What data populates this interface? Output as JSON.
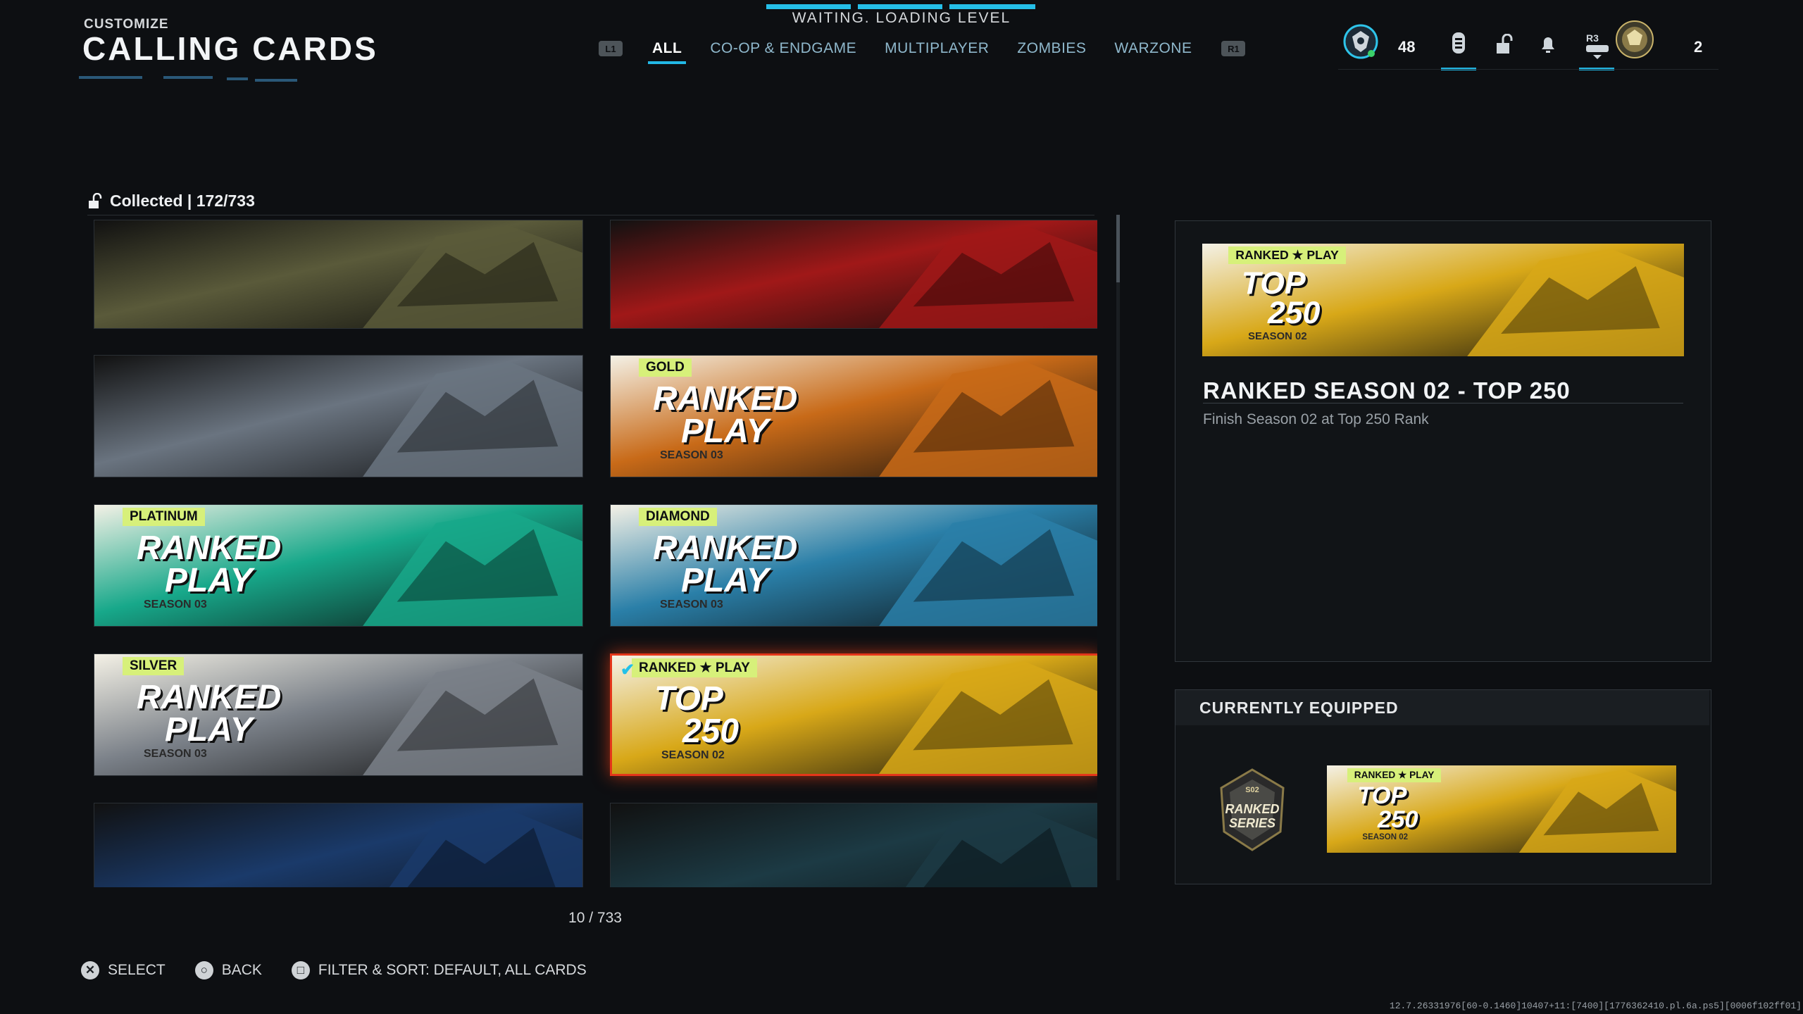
{
  "header": {
    "subtitle": "CUSTOMIZE",
    "title": "CALLING CARDS",
    "loading_text": "WAITING. LOADING LEVEL"
  },
  "nav": {
    "left_bumper": "L1",
    "right_bumper": "R1",
    "tabs": [
      {
        "label": "ALL",
        "active": true
      },
      {
        "label": "CO-OP & ENDGAME",
        "active": false
      },
      {
        "label": "MULTIPLAYER",
        "active": false
      },
      {
        "label": "ZOMBIES",
        "active": false
      },
      {
        "label": "WARZONE",
        "active": false
      }
    ]
  },
  "hud": {
    "level": "48",
    "r3_label": "R3",
    "count": "2",
    "icons": [
      "rank-emblem-icon",
      "inventory-icon",
      "lock-icon",
      "bell-icon",
      "controller-icon",
      "player-emblem-icon"
    ]
  },
  "collection": {
    "label": "Collected | 172/733",
    "pager": "10 / 733"
  },
  "cards": [
    {
      "name": "soldier-firefight-card",
      "theme": "#5a5a3a",
      "badge": "",
      "line1": "",
      "line2": "",
      "season": "",
      "selected": false
    },
    {
      "name": "commando-pistol-card",
      "theme": "#a01818",
      "badge": "",
      "line1": "",
      "line2": "",
      "season": "",
      "selected": false
    },
    {
      "name": "twin-snipers-card",
      "theme": "#6a7480",
      "badge": "",
      "line1": "",
      "line2": "",
      "season": "",
      "selected": false
    },
    {
      "name": "ranked-play-gold-card",
      "theme": "#c86a18",
      "badge": "GOLD",
      "line1": "RANKED",
      "line2": "PLAY",
      "season": "SEASON 03",
      "selected": false
    },
    {
      "name": "ranked-play-platinum-card",
      "theme": "#17a88a",
      "badge": "PLATINUM",
      "line1": "RANKED",
      "line2": "PLAY",
      "season": "SEASON 03",
      "selected": false
    },
    {
      "name": "ranked-play-diamond-card",
      "theme": "#2a7fa8",
      "badge": "DIAMOND",
      "line1": "RANKED",
      "line2": "PLAY",
      "season": "SEASON 03",
      "selected": false
    },
    {
      "name": "ranked-play-silver-card",
      "theme": "#7a8088",
      "badge": "SILVER",
      "line1": "RANKED",
      "line2": "PLAY",
      "season": "SEASON 03",
      "selected": false
    },
    {
      "name": "ranked-top-250-card",
      "theme": "#d8a818",
      "badge": "RANKED ★ PLAY",
      "line1": "TOP",
      "line2": "250",
      "season": "SEASON 02",
      "selected": true
    },
    {
      "name": "storm-moon-card",
      "theme": "#1a3a6a",
      "badge": "",
      "line1": "",
      "line2": "",
      "season": "",
      "selected": false
    },
    {
      "name": "combat-knife-card",
      "theme": "#1c3a44",
      "badge": "",
      "line1": "",
      "line2": "",
      "season": "",
      "selected": false
    }
  ],
  "detail": {
    "title": "RANKED SEASON 02 - TOP 250",
    "description": "Finish Season 02 at Top 250 Rank",
    "badge": "RANKED ★ PLAY",
    "line1": "TOP",
    "line2": "250",
    "season": "SEASON 02"
  },
  "equipped": {
    "title": "CURRENTLY EQUIPPED",
    "emblem_year": "S02",
    "emblem_line1": "RANKED",
    "emblem_line2": "SERIES",
    "badge": "RANKED ★ PLAY",
    "line1": "TOP",
    "line2": "250",
    "season": "SEASON 02"
  },
  "footer": {
    "select_glyph": "✕",
    "select_label": "SELECT",
    "back_glyph": "○",
    "back_label": "BACK",
    "filter_glyph": "□",
    "filter_label": "FILTER & SORT: DEFAULT, ALL CARDS"
  },
  "build_info": "12.7.26331976[60-0.1460]10407+11:[7400][1776362410.pl.6a.ps5][0006f102ff01]",
  "colors": {
    "accent_blue": "#22b8e5",
    "selected_border": "#e4361a",
    "background": "#0d0f12"
  }
}
